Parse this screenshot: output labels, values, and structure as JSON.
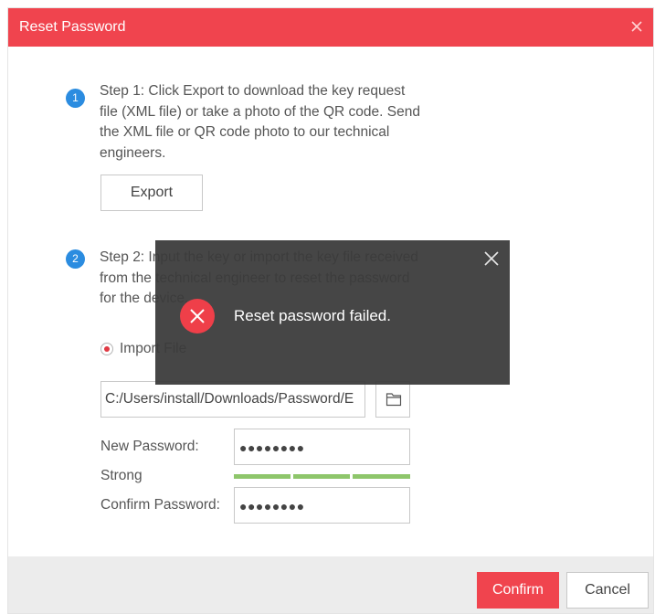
{
  "dialog": {
    "title": "Reset Password",
    "close_icon": "close-icon",
    "title_bar_color": "#f0444e"
  },
  "step1": {
    "badge": "1",
    "lines": [
      "Step 1: Click Export to download the key request",
      "file (XML file) or take a photo of the QR code. Send",
      "the XML file or QR code photo to our technical",
      "engineers."
    ],
    "export_label": "Export"
  },
  "step2": {
    "badge": "2",
    "lines": [
      "Step 2: Input the key or import the key file received",
      "from the technical engineer to reset the password",
      "for the device."
    ],
    "import_option": "Import File",
    "import_selected": true,
    "file_path": "C:/Users/install/Downloads/Password/E",
    "folder_icon": "folder-icon",
    "new_password_label": "New Password:",
    "new_password_value": "●●●●●●●●",
    "strength_label": "Strong",
    "strength_level": 3,
    "strength_color": "#8ec66b",
    "confirm_password_label": "Confirm Password:",
    "confirm_password_value": "●●●●●●●●"
  },
  "footer": {
    "confirm_label": "Confirm",
    "cancel_label": "Cancel",
    "accent_color": "#f0444e"
  },
  "toast": {
    "message": "Reset password failed.",
    "icon": "error-icon",
    "close_icon": "close-icon"
  }
}
